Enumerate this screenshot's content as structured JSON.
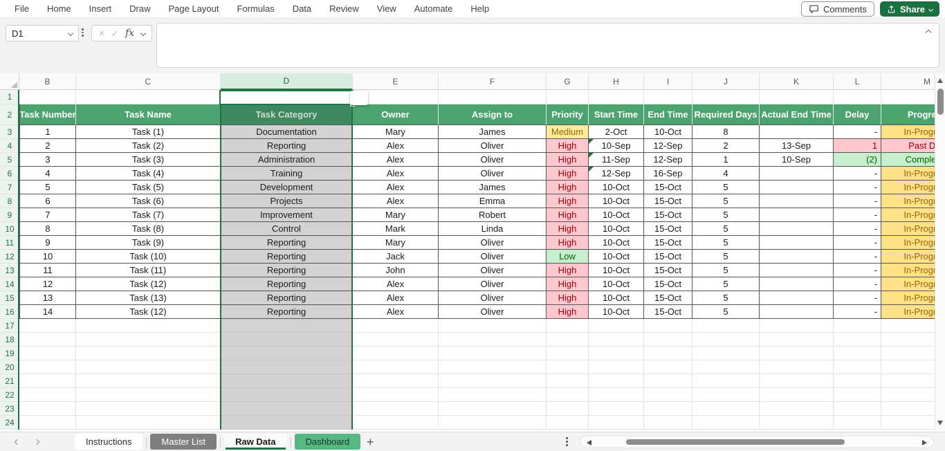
{
  "menu": {
    "items": [
      "File",
      "Home",
      "Insert",
      "Draw",
      "Page Layout",
      "Formulas",
      "Data",
      "Review",
      "View",
      "Automate",
      "Help"
    ],
    "comments_label": "Comments",
    "share_label": "Share"
  },
  "formula_bar": {
    "name_box_value": "D1",
    "fx_label": "fx",
    "cancel_glyph": "×",
    "confirm_glyph": "✓",
    "formula_value": ""
  },
  "grid": {
    "visible_columns": [
      "B",
      "C",
      "D",
      "E",
      "F",
      "G",
      "H",
      "I",
      "J",
      "K",
      "L",
      "M"
    ],
    "selected_column": "D",
    "active_cell": "D1",
    "row_start": 1,
    "row_end": 24,
    "table_header_row": 2
  },
  "table": {
    "headers": [
      "Task Number",
      "Task Name",
      "Task Category",
      "Owner",
      "Assign to",
      "Priority",
      "Start Time",
      "End Time",
      "Required Days",
      "Actual End Time",
      "Delay",
      "Progress"
    ],
    "rows": [
      {
        "num": "1",
        "name": "Task (1)",
        "category": "Documentation",
        "owner": "Mary",
        "assign": "James",
        "priority": "Medium",
        "priority_style": "neutral",
        "start": "2-Oct",
        "start_flag": false,
        "end": "10-Oct",
        "days": "8",
        "actual": "",
        "delay": "-",
        "delay_style": "plain",
        "progress": "In-Progress",
        "progress_style": "gold"
      },
      {
        "num": "2",
        "name": "Task (2)",
        "category": "Reporting",
        "owner": "Alex",
        "assign": "Oliver",
        "priority": "High",
        "priority_style": "bad",
        "start": "10-Sep",
        "start_flag": true,
        "end": "12-Sep",
        "days": "2",
        "actual": "13-Sep",
        "delay": "1",
        "delay_style": "bad",
        "progress": "Past Due",
        "progress_style": "bad"
      },
      {
        "num": "3",
        "name": "Task (3)",
        "category": "Administration",
        "owner": "Alex",
        "assign": "Oliver",
        "priority": "High",
        "priority_style": "bad",
        "start": "11-Sep",
        "start_flag": true,
        "end": "12-Sep",
        "days": "1",
        "actual": "10-Sep",
        "delay": "(2)",
        "delay_style": "good",
        "progress": "Completed",
        "progress_style": "good"
      },
      {
        "num": "4",
        "name": "Task (4)",
        "category": "Training",
        "owner": "Alex",
        "assign": "Oliver",
        "priority": "High",
        "priority_style": "bad",
        "start": "12-Sep",
        "start_flag": true,
        "end": "16-Sep",
        "days": "4",
        "actual": "",
        "delay": "-",
        "delay_style": "plain",
        "progress": "In-Progress",
        "progress_style": "gold"
      },
      {
        "num": "5",
        "name": "Task (5)",
        "category": "Development",
        "owner": "Alex",
        "assign": "James",
        "priority": "High",
        "priority_style": "bad",
        "start": "10-Oct",
        "start_flag": false,
        "end": "15-Oct",
        "days": "5",
        "actual": "",
        "delay": "-",
        "delay_style": "plain",
        "progress": "In-Progress",
        "progress_style": "gold"
      },
      {
        "num": "6",
        "name": "Task (6)",
        "category": "Projects",
        "owner": "Alex",
        "assign": "Emma",
        "priority": "High",
        "priority_style": "bad",
        "start": "10-Oct",
        "start_flag": false,
        "end": "15-Oct",
        "days": "5",
        "actual": "",
        "delay": "-",
        "delay_style": "plain",
        "progress": "In-Progress",
        "progress_style": "gold"
      },
      {
        "num": "7",
        "name": "Task (7)",
        "category": "Improvement",
        "owner": "Mary",
        "assign": "Robert",
        "priority": "High",
        "priority_style": "bad",
        "start": "10-Oct",
        "start_flag": false,
        "end": "15-Oct",
        "days": "5",
        "actual": "",
        "delay": "-",
        "delay_style": "plain",
        "progress": "In-Progress",
        "progress_style": "gold"
      },
      {
        "num": "8",
        "name": "Task (8)",
        "category": "Control",
        "owner": "Mark",
        "assign": "Linda",
        "priority": "High",
        "priority_style": "bad",
        "start": "10-Oct",
        "start_flag": false,
        "end": "15-Oct",
        "days": "5",
        "actual": "",
        "delay": "-",
        "delay_style": "plain",
        "progress": "In-Progress",
        "progress_style": "gold"
      },
      {
        "num": "9",
        "name": "Task (9)",
        "category": "Reporting",
        "owner": "Mary",
        "assign": "Oliver",
        "priority": "High",
        "priority_style": "bad",
        "start": "10-Oct",
        "start_flag": false,
        "end": "15-Oct",
        "days": "5",
        "actual": "",
        "delay": "-",
        "delay_style": "plain",
        "progress": "In-Progress",
        "progress_style": "gold"
      },
      {
        "num": "10",
        "name": "Task (10)",
        "category": "Reporting",
        "owner": "Jack",
        "assign": "Oliver",
        "priority": "Low",
        "priority_style": "good",
        "start": "10-Oct",
        "start_flag": false,
        "end": "15-Oct",
        "days": "5",
        "actual": "",
        "delay": "-",
        "delay_style": "plain",
        "progress": "In-Progress",
        "progress_style": "gold"
      },
      {
        "num": "11",
        "name": "Task (11)",
        "category": "Reporting",
        "owner": "John",
        "assign": "Oliver",
        "priority": "High",
        "priority_style": "bad",
        "start": "10-Oct",
        "start_flag": false,
        "end": "15-Oct",
        "days": "5",
        "actual": "",
        "delay": "-",
        "delay_style": "plain",
        "progress": "In-Progress",
        "progress_style": "gold"
      },
      {
        "num": "12",
        "name": "Task (12)",
        "category": "Reporting",
        "owner": "Alex",
        "assign": "Oliver",
        "priority": "High",
        "priority_style": "bad",
        "start": "10-Oct",
        "start_flag": false,
        "end": "15-Oct",
        "days": "5",
        "actual": "",
        "delay": "-",
        "delay_style": "plain",
        "progress": "In-Progress",
        "progress_style": "gold"
      },
      {
        "num": "13",
        "name": "Task (13)",
        "category": "Reporting",
        "owner": "Alex",
        "assign": "Oliver",
        "priority": "High",
        "priority_style": "bad",
        "start": "10-Oct",
        "start_flag": false,
        "end": "15-Oct",
        "days": "5",
        "actual": "",
        "delay": "-",
        "delay_style": "plain",
        "progress": "In-Progress",
        "progress_style": "gold"
      },
      {
        "num": "14",
        "name": "Task (12)",
        "category": "Reporting",
        "owner": "Alex",
        "assign": "Oliver",
        "priority": "High",
        "priority_style": "bad",
        "start": "10-Oct",
        "start_flag": false,
        "end": "15-Oct",
        "days": "5",
        "actual": "",
        "delay": "-",
        "delay_style": "plain",
        "progress": "In-Progress",
        "progress_style": "gold"
      }
    ]
  },
  "sheet_tabs": {
    "tabs": [
      {
        "label": "Instructions",
        "style": "plain"
      },
      {
        "label": "Master List",
        "style": "gray"
      },
      {
        "label": "Raw Data",
        "style": "active"
      },
      {
        "label": "Dashboard",
        "style": "green"
      }
    ],
    "add_label": "+"
  },
  "colors": {
    "accent_green": "#217346",
    "table_header_bg": "#4ba46f",
    "selected_header_bg": "#3e8960",
    "bad_bg": "#ffc7ce",
    "bad_text": "#9c0006",
    "good_bg": "#c6efce",
    "good_text": "#006100",
    "neutral_bg": "#ffeb9c",
    "neutral_text": "#9c6500",
    "inprogress_bg": "#ffe189",
    "inprogress_text": "#9c6500",
    "share_button_bg": "#1b703f",
    "dashboard_tab_bg": "#57b781",
    "master_tab_bg": "#7f7f7f",
    "selected_column_overlay": "#d2d2d2"
  }
}
